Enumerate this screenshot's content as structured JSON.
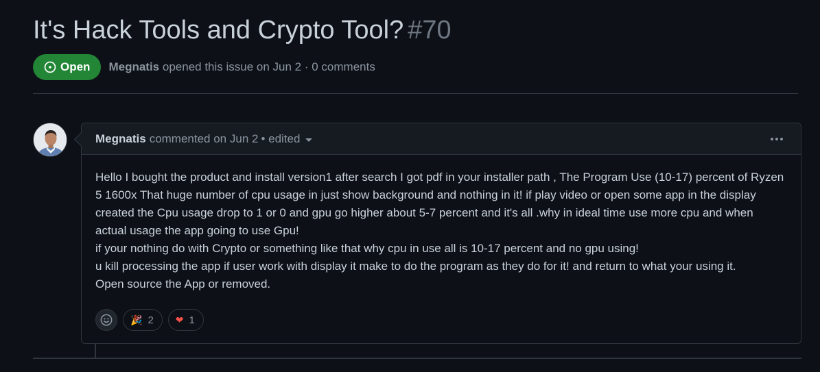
{
  "issue": {
    "title": "It's Hack Tools and Crypto Tool?",
    "number": "#70",
    "state": "Open",
    "author": "Megnatis",
    "meta_text": "opened this issue on Jun 2 · 0 comments"
  },
  "comment": {
    "author": "Megnatis",
    "meta": "commented on Jun 2",
    "edited": "• edited",
    "body": [
      "Hello I bought the product and install version1 after search I got pdf in your installer path , The Program Use (10-17) percent of Ryzen 5 1600x That huge number of cpu usage in just show background and nothing in it! if play video or open some app in the display created the Cpu usage drop to 1 or 0 and gpu go higher about 5-7 percent and it's all .why in ideal time use more cpu and when actual usage the app going to use Gpu!",
      "if your nothing do with Crypto or something like that why cpu in use all is 10-17 percent and no gpu using!",
      "u kill processing the app if user work with display it make to do the program as they do for it! and return to what your using it.",
      "Open source the App or removed."
    ],
    "reactions": [
      {
        "icon": "tada-icon",
        "emoji": "🎉",
        "count": "2"
      },
      {
        "icon": "heart-icon",
        "emoji": "❤",
        "count": "1"
      }
    ]
  },
  "colors": {
    "background": "#0d1117",
    "open_badge": "#238636",
    "border": "#30363d",
    "muted_text": "#8b949e",
    "heart": "#f85149"
  }
}
